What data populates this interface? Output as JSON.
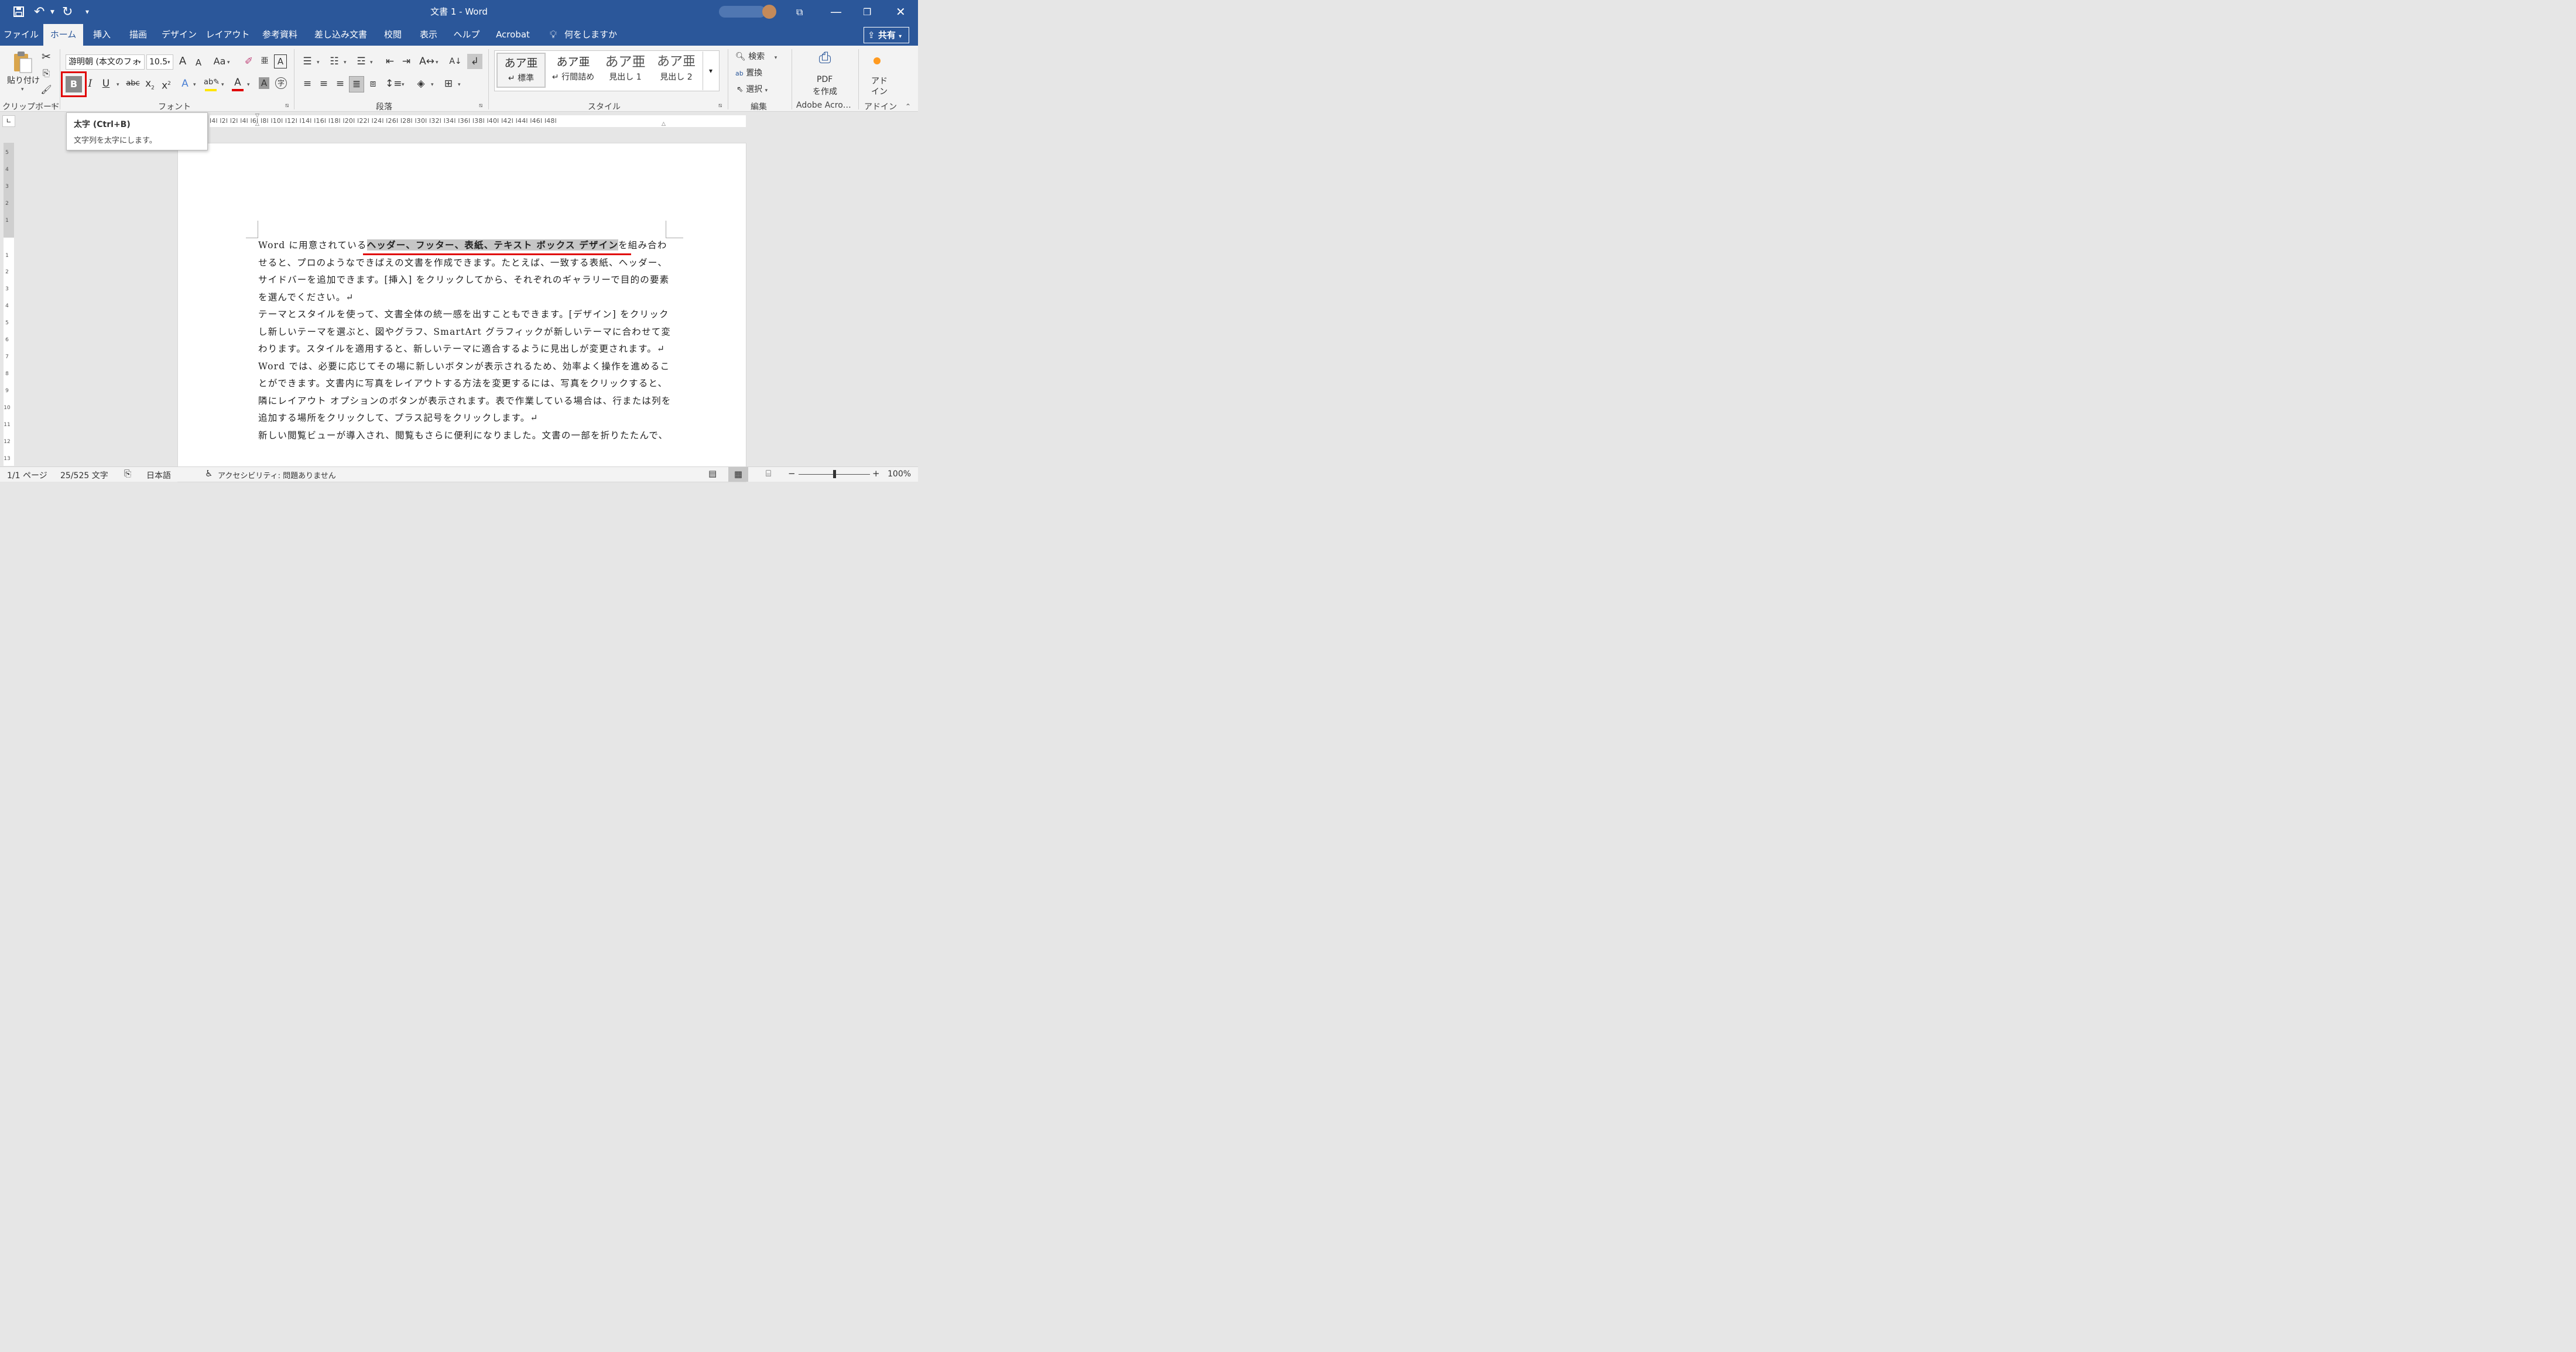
{
  "app": {
    "window_title": "文書 1 - Word",
    "share_label": "共有"
  },
  "titlebar": {
    "save_icon": "save-icon",
    "undo_icon": "undo-icon",
    "redo_icon": "redo-icon",
    "customize_icon": "customize-qat-icon"
  },
  "tabs": [
    "ファイル",
    "ホーム",
    "挿入",
    "描画",
    "デザイン",
    "レイアウト",
    "参考資料",
    "差し込み文書",
    "校閲",
    "表示",
    "ヘルプ",
    "Acrobat"
  ],
  "active_tab": "ホーム",
  "tell_me": "何をしますか",
  "ribbon": {
    "clipboard": {
      "paste_label": "貼り付け",
      "group_label": "クリップボード"
    },
    "font": {
      "font_name": "游明朝 (本文のフォ",
      "font_size": "10.5",
      "grow_label": "A",
      "shrink_label": "A",
      "case_label": "Aa",
      "bold_label": "B",
      "italic_label": "I",
      "underline_label": "U",
      "strike_label": "abc",
      "subscript_label": "x",
      "subscript_small": "2",
      "superscript_label": "x",
      "superscript_small": "2",
      "group_label": "フォント"
    },
    "paragraph": {
      "group_label": "段落"
    },
    "styles": {
      "items": [
        {
          "preview": "あア亜",
          "name": "↵ 標準"
        },
        {
          "preview": "あア亜",
          "name": "↵ 行間詰め"
        },
        {
          "preview": "あア亜",
          "name": "見出し 1"
        },
        {
          "preview": "あア亜",
          "name": "見出し 2"
        }
      ],
      "group_label": "スタイル"
    },
    "editing": {
      "find": "検索",
      "replace": "置換",
      "select": "選択",
      "group_label": "編集"
    },
    "acrobat": {
      "pdf_line1": "PDF",
      "pdf_line2": "を作成",
      "group_label": "Adobe Acro…"
    },
    "addins": {
      "line1": "アド",
      "line2": "イン",
      "group_label": "アドイン"
    }
  },
  "tooltip": {
    "title": "太字 (Ctrl+B)",
    "description": "文字列を太字にします。"
  },
  "ruler": {
    "horizontal": "l4l  l2l        l2l   l4l   l6l   l8l  l10l  l12l  l14l  l16l  l18l  l20l  l22l  l24l  l26l  l28l  l30l  l32l  l34l  l36l  l38l  l40l  l42l  l44l  l46l  l48l",
    "vertical_top": [
      "5",
      "4",
      "3",
      "2",
      "1"
    ],
    "vertical_body": [
      "1",
      "1",
      "2",
      "3",
      "4",
      "5",
      "6",
      "7",
      "8",
      "9",
      "10",
      "11",
      "12",
      "13"
    ]
  },
  "document": {
    "p1_before": "Word に用意されている",
    "p1_highlight": "ヘッダー、フッター、表紙、テキスト ボックス デザイン",
    "p1_after": "を組み合わせると、プロのようなできばえの文書を作成できます。たとえば、一致する表紙、ヘッダー、サイドバーを追加できます。[挿入] をクリックしてから、それぞれのギャラリーで目的の要素を選んでください。↵",
    "p2": "テーマとスタイルを使って、文書全体の統一感を出すこともできます。[デザイン] をクリックし新しいテーマを選ぶと、図やグラフ、SmartArt グラフィックが新しいテーマに合わせて変わります。スタイルを適用すると、新しいテーマに適合するように見出しが変更されます。↵",
    "p3": "Word では、必要に応じてその場に新しいボタンが表示されるため、効率よく操作を進めることができます。文書内に写真をレイアウトする方法を変更するには、写真をクリックすると、隣にレイアウト オプションのボタンが表示されます。表で作業している場合は、行または列を追加する場所をクリックして、プラス記号をクリックします。↵",
    "p4": "新しい閲覧ビューが導入され、閲覧もさらに便利になりました。文書の一部を折りたたんで、"
  },
  "status": {
    "page": "1/1 ページ",
    "words": "25/525 文字",
    "language": "日本語",
    "accessibility": "アクセシビリティ: 問題ありません",
    "zoom": "100%",
    "zoom_fraction": 0.5
  },
  "colors": {
    "brand": "#2b579a",
    "highlight_red": "#e00000",
    "font_color_bar": "#e00000",
    "highlighter_bar": "#ffe600"
  }
}
